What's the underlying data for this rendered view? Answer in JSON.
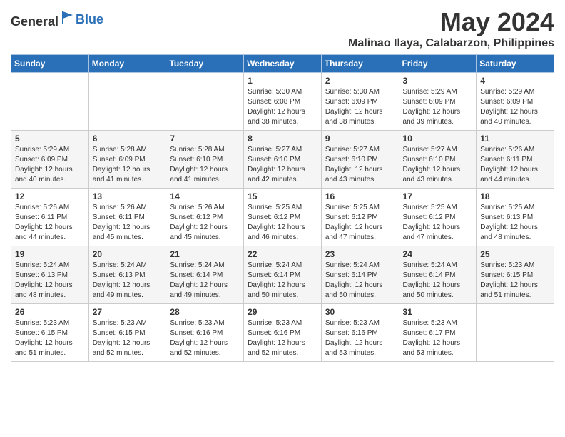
{
  "header": {
    "logo_general": "General",
    "logo_blue": "Blue",
    "month_title": "May 2024",
    "location": "Malinao Ilaya, Calabarzon, Philippines"
  },
  "days_of_week": [
    "Sunday",
    "Monday",
    "Tuesday",
    "Wednesday",
    "Thursday",
    "Friday",
    "Saturday"
  ],
  "weeks": [
    [
      {
        "day": "",
        "info": ""
      },
      {
        "day": "",
        "info": ""
      },
      {
        "day": "",
        "info": ""
      },
      {
        "day": "1",
        "info": "Sunrise: 5:30 AM\nSunset: 6:08 PM\nDaylight: 12 hours\nand 38 minutes."
      },
      {
        "day": "2",
        "info": "Sunrise: 5:30 AM\nSunset: 6:09 PM\nDaylight: 12 hours\nand 38 minutes."
      },
      {
        "day": "3",
        "info": "Sunrise: 5:29 AM\nSunset: 6:09 PM\nDaylight: 12 hours\nand 39 minutes."
      },
      {
        "day": "4",
        "info": "Sunrise: 5:29 AM\nSunset: 6:09 PM\nDaylight: 12 hours\nand 40 minutes."
      }
    ],
    [
      {
        "day": "5",
        "info": "Sunrise: 5:29 AM\nSunset: 6:09 PM\nDaylight: 12 hours\nand 40 minutes."
      },
      {
        "day": "6",
        "info": "Sunrise: 5:28 AM\nSunset: 6:09 PM\nDaylight: 12 hours\nand 41 minutes."
      },
      {
        "day": "7",
        "info": "Sunrise: 5:28 AM\nSunset: 6:10 PM\nDaylight: 12 hours\nand 41 minutes."
      },
      {
        "day": "8",
        "info": "Sunrise: 5:27 AM\nSunset: 6:10 PM\nDaylight: 12 hours\nand 42 minutes."
      },
      {
        "day": "9",
        "info": "Sunrise: 5:27 AM\nSunset: 6:10 PM\nDaylight: 12 hours\nand 43 minutes."
      },
      {
        "day": "10",
        "info": "Sunrise: 5:27 AM\nSunset: 6:10 PM\nDaylight: 12 hours\nand 43 minutes."
      },
      {
        "day": "11",
        "info": "Sunrise: 5:26 AM\nSunset: 6:11 PM\nDaylight: 12 hours\nand 44 minutes."
      }
    ],
    [
      {
        "day": "12",
        "info": "Sunrise: 5:26 AM\nSunset: 6:11 PM\nDaylight: 12 hours\nand 44 minutes."
      },
      {
        "day": "13",
        "info": "Sunrise: 5:26 AM\nSunset: 6:11 PM\nDaylight: 12 hours\nand 45 minutes."
      },
      {
        "day": "14",
        "info": "Sunrise: 5:26 AM\nSunset: 6:12 PM\nDaylight: 12 hours\nand 45 minutes."
      },
      {
        "day": "15",
        "info": "Sunrise: 5:25 AM\nSunset: 6:12 PM\nDaylight: 12 hours\nand 46 minutes."
      },
      {
        "day": "16",
        "info": "Sunrise: 5:25 AM\nSunset: 6:12 PM\nDaylight: 12 hours\nand 47 minutes."
      },
      {
        "day": "17",
        "info": "Sunrise: 5:25 AM\nSunset: 6:12 PM\nDaylight: 12 hours\nand 47 minutes."
      },
      {
        "day": "18",
        "info": "Sunrise: 5:25 AM\nSunset: 6:13 PM\nDaylight: 12 hours\nand 48 minutes."
      }
    ],
    [
      {
        "day": "19",
        "info": "Sunrise: 5:24 AM\nSunset: 6:13 PM\nDaylight: 12 hours\nand 48 minutes."
      },
      {
        "day": "20",
        "info": "Sunrise: 5:24 AM\nSunset: 6:13 PM\nDaylight: 12 hours\nand 49 minutes."
      },
      {
        "day": "21",
        "info": "Sunrise: 5:24 AM\nSunset: 6:14 PM\nDaylight: 12 hours\nand 49 minutes."
      },
      {
        "day": "22",
        "info": "Sunrise: 5:24 AM\nSunset: 6:14 PM\nDaylight: 12 hours\nand 50 minutes."
      },
      {
        "day": "23",
        "info": "Sunrise: 5:24 AM\nSunset: 6:14 PM\nDaylight: 12 hours\nand 50 minutes."
      },
      {
        "day": "24",
        "info": "Sunrise: 5:24 AM\nSunset: 6:14 PM\nDaylight: 12 hours\nand 50 minutes."
      },
      {
        "day": "25",
        "info": "Sunrise: 5:23 AM\nSunset: 6:15 PM\nDaylight: 12 hours\nand 51 minutes."
      }
    ],
    [
      {
        "day": "26",
        "info": "Sunrise: 5:23 AM\nSunset: 6:15 PM\nDaylight: 12 hours\nand 51 minutes."
      },
      {
        "day": "27",
        "info": "Sunrise: 5:23 AM\nSunset: 6:15 PM\nDaylight: 12 hours\nand 52 minutes."
      },
      {
        "day": "28",
        "info": "Sunrise: 5:23 AM\nSunset: 6:16 PM\nDaylight: 12 hours\nand 52 minutes."
      },
      {
        "day": "29",
        "info": "Sunrise: 5:23 AM\nSunset: 6:16 PM\nDaylight: 12 hours\nand 52 minutes."
      },
      {
        "day": "30",
        "info": "Sunrise: 5:23 AM\nSunset: 6:16 PM\nDaylight: 12 hours\nand 53 minutes."
      },
      {
        "day": "31",
        "info": "Sunrise: 5:23 AM\nSunset: 6:17 PM\nDaylight: 12 hours\nand 53 minutes."
      },
      {
        "day": "",
        "info": ""
      }
    ]
  ]
}
